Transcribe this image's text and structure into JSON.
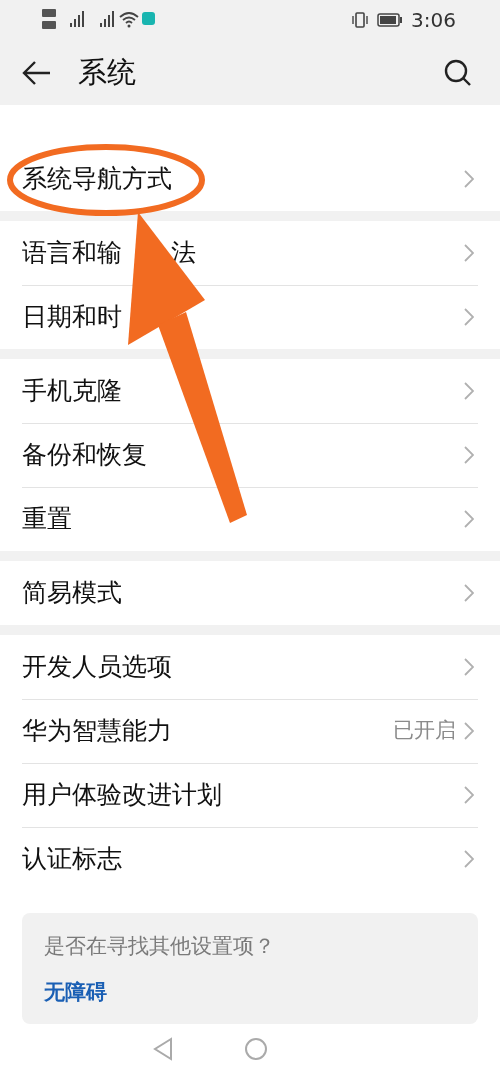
{
  "status_bar": {
    "time": "3:06"
  },
  "header": {
    "title": "系统"
  },
  "groups": [
    {
      "rows": [
        {
          "label": "系统导航方式"
        }
      ]
    },
    {
      "rows": [
        {
          "label": "语言和输",
          "label_tail": "法"
        },
        {
          "label": "日期和时"
        }
      ]
    },
    {
      "rows": [
        {
          "label": "手机克隆"
        },
        {
          "label": "备份和恢复"
        },
        {
          "label": "重置"
        }
      ]
    },
    {
      "rows": [
        {
          "label": "简易模式"
        }
      ]
    },
    {
      "rows": [
        {
          "label": "开发人员选项"
        },
        {
          "label": "华为智慧能力",
          "value": "已开启"
        },
        {
          "label": "用户体验改进计划"
        },
        {
          "label": "认证标志"
        }
      ]
    }
  ],
  "suggestion_card": {
    "question": "是否在寻找其他设置项？",
    "link": "无障碍"
  }
}
